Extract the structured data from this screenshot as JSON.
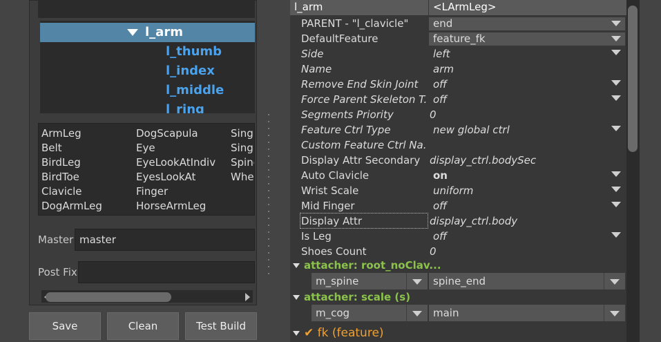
{
  "tree": {
    "items": [
      {
        "label": "l_arm",
        "selected": true
      },
      {
        "label": "l_thumb"
      },
      {
        "label": "l_index"
      },
      {
        "label": "l_middle"
      },
      {
        "label": "l_ring"
      }
    ]
  },
  "types": {
    "col1": [
      "ArmLeg",
      "Belt",
      "BirdLeg",
      "BirdToe",
      "Clavicle",
      "DogArmLeg"
    ],
    "col2": [
      "DogScapula",
      "Eye",
      "EyeLookAtIndiv",
      "EyesLookAt",
      "Finger",
      "HorseArmLeg"
    ],
    "col3": [
      "Singl",
      "Singl",
      "Spine",
      "Whee"
    ]
  },
  "form": {
    "master_label": "Master",
    "master_value": "master",
    "postfix_label": "Post Fix",
    "postfix_value": ""
  },
  "buttons": {
    "save": "Save",
    "clean": "Clean",
    "test_build": "Test Build"
  },
  "attributes": {
    "header_name": "l_arm",
    "header_value": "<LArmLeg>",
    "rows": [
      {
        "name": "PARENT - \"l_clavicle\"",
        "value": "end"
      },
      {
        "name": "DefaultFeature",
        "value": "feature_fk"
      },
      {
        "name": "Side",
        "value": "left"
      },
      {
        "name": "Name",
        "value": "arm"
      },
      {
        "name": "Remove End Skin Joint",
        "value": "off"
      },
      {
        "name": "Force Parent Skeleton T...",
        "value": "off"
      },
      {
        "name": "Segments Priority",
        "value": "0"
      },
      {
        "name": "Feature Ctrl Type",
        "value": "new global ctrl"
      },
      {
        "name": "Custom Feature Ctrl Na...",
        "value": ""
      },
      {
        "name": "Display Attr Secondary",
        "value": "display_ctrl.bodySec"
      },
      {
        "name": "Auto Clavicle",
        "value": "on"
      },
      {
        "name": "Wrist Scale",
        "value": "uniform"
      },
      {
        "name": "Mid Finger",
        "value": "off"
      },
      {
        "name": "Display Attr",
        "value": "display_ctrl.body"
      },
      {
        "name": "Is Leg",
        "value": "off"
      },
      {
        "name": "Shoes Count",
        "value": "0"
      }
    ]
  },
  "attachers": [
    {
      "title": "attacher: root_noClav...",
      "left": "m_spine",
      "right": "spine_end"
    },
    {
      "title": "attacher: scale (s)",
      "left": "m_cog",
      "right": "main"
    }
  ],
  "feature": {
    "check": "✔",
    "label": "fk (feature)"
  },
  "colors": {
    "selection": "#5285a6",
    "tree_child": "#4aa3ee",
    "attacher": "#8bc34a",
    "feature": "#f0a030"
  }
}
